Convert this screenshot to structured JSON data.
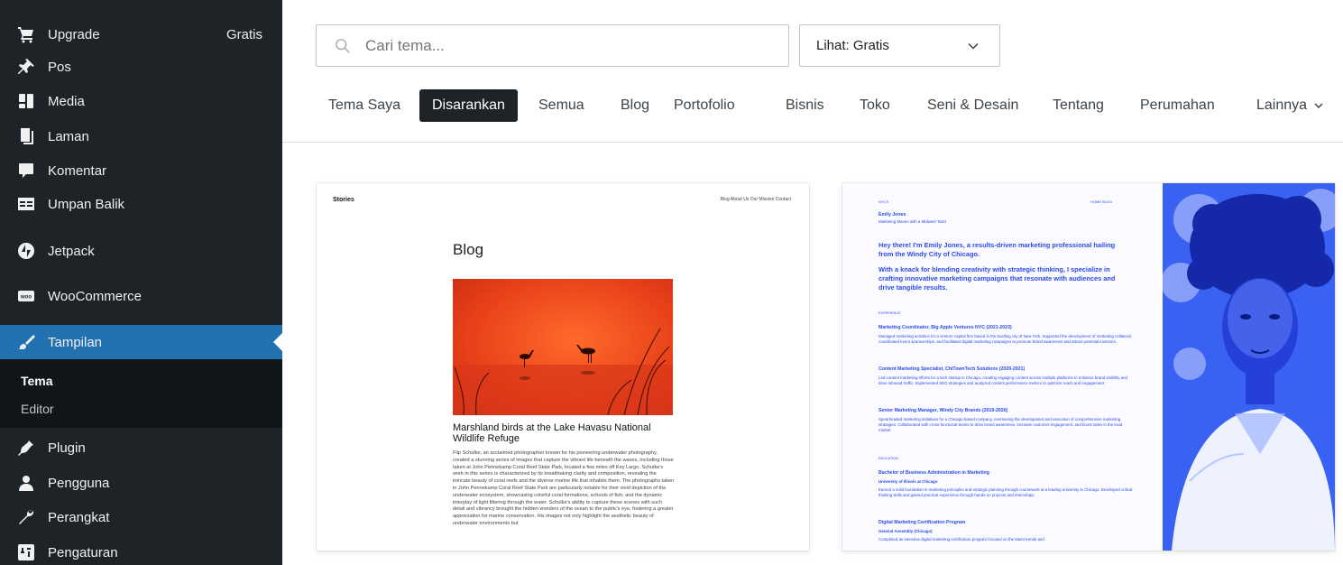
{
  "sidebar": {
    "items": [
      {
        "label": "Upgrade",
        "badge": "Gratis",
        "icon": "cart-icon"
      },
      {
        "label": "Pos",
        "icon": "pin-icon"
      },
      {
        "label": "Media",
        "icon": "media-icon"
      },
      {
        "label": "Laman",
        "icon": "page-icon"
      },
      {
        "label": "Komentar",
        "icon": "comment-icon"
      },
      {
        "label": "Umpan Balik",
        "icon": "feedback-icon"
      },
      {
        "label": "Jetpack",
        "icon": "jetpack-icon"
      },
      {
        "label": "WooCommerce",
        "icon": "woo-icon"
      },
      {
        "label": "Tampilan",
        "icon": "brush-icon"
      },
      {
        "label": "Plugin",
        "icon": "plugin-icon"
      },
      {
        "label": "Pengguna",
        "icon": "user-icon"
      },
      {
        "label": "Perangkat",
        "icon": "wrench-icon"
      },
      {
        "label": "Pengaturan",
        "icon": "settings-icon"
      }
    ],
    "submenu": [
      {
        "label": "Tema"
      },
      {
        "label": "Editor"
      }
    ]
  },
  "search": {
    "placeholder": "Cari tema...",
    "value": ""
  },
  "view_select": {
    "label": "Lihat: Gratis"
  },
  "tabs": [
    {
      "label": "Tema Saya"
    },
    {
      "label": "Disarankan"
    },
    {
      "label": "Semua"
    },
    {
      "label": "Blog"
    },
    {
      "label": "Portofolio"
    },
    {
      "label": "Bisnis"
    },
    {
      "label": "Toko"
    },
    {
      "label": "Seni & Desain"
    },
    {
      "label": "Tentang"
    },
    {
      "label": "Perumahan"
    },
    {
      "label": "Lainnya"
    }
  ],
  "cards": [
    {
      "site_title": "Stories",
      "nav": "Blog   About Us   Our Mission   Contact",
      "heading": "Blog",
      "post_title": "Marshland birds at the Lake Havasu National Wildlife Refuge",
      "post_body": "Flip Schulke, an acclaimed photographer known for his pioneering underwater photography, created a stunning series of images that capture the vibrant life beneath the waves, including those taken at John Pennekamp Coral Reef State Park, located a few miles off Key Largo. Schulke's work in this series is characterized by its breathtaking clarity and composition, revealing the intricate beauty of coral reefs and the diverse marine life that inhabits them. The photographs taken in John Pennekamp Coral Reef State Park are particularly notable for their vivid depiction of the underwater ecosystem, showcasing colorful coral formations, schools of fish, and the dynamic interplay of light filtering through the water. Schulke's ability to capture these scenes with such detail and vibrancy brought the hidden wonders of the ocean to the public's eye, fostering a greater appreciation for marine conservation. His images not only highlight the aesthetic beauty of underwater environments but"
    },
    {
      "tag": "NYCS",
      "nav": "HOME   BLOG",
      "name": "Emily Jones",
      "subtitle": "Marketing Maven with a Midwest Twist",
      "intro": "Hey there! I'm Emily Jones, a results-driven marketing professional hailing from the Windy City of Chicago.",
      "intro2": "With a knack for blending creativity with strategic thinking, I specialize in crafting innovative marketing campaigns that resonate with audiences and drive tangible results.",
      "experience_label": "EXPERIENCE",
      "job1_title": "Marketing Coordinator, Big Apple Ventures NYC (2021-2023)",
      "job1_desc": "Managed marketing activities for a venture capital firm based in the bustling city of New York. Supported the development of marketing collateral, coordinated event sponsorships, and facilitated digital marketing campaigns to promote brand awareness and attract potential investors.",
      "job2_title": "Content Marketing Specialist, ChiTownTech Solutions (2020-2021)",
      "job2_desc": "Led content marketing efforts for a tech startup in Chicago, creating engaging content across multiple platforms to enhance brand visibility and drive inbound traffic. Implemented SEO strategies and analyzed content performance metrics to optimize reach and engagement.",
      "job3_title": "Senior Marketing Manager, Windy City Brands (2019-2020)",
      "job3_desc": "Spearheaded marketing initiatives for a Chicago-based company, overseeing the development and execution of comprehensive marketing strategies. Collaborated with cross-functional teams to drive brand awareness, increase customer engagement, and boost sales in the local market.",
      "education_label": "EDUCATION",
      "edu1_title": "Bachelor of Business Administration in Marketing",
      "edu1_school": "University of Illinois at Chicago",
      "edu1_desc": "Earned a solid foundation in marketing principles and strategic planning through coursework at a leading university in Chicago. Developed critical thinking skills and gained practical experience through hands-on projects and internships.",
      "edu2_title": "Digital Marketing Certification Program",
      "edu2_school": "General Assembly (Chicago)",
      "edu2_desc": "Completed an intensive digital marketing certification program focused on the latest trends and"
    }
  ],
  "colors": {
    "sidebar_bg": "#1d2327",
    "active_bg": "#2271b1",
    "submenu_bg": "#101517",
    "tab_selected_bg": "#1d2327",
    "resume_blue": "#2b4bea",
    "photo_red": "#e8401a"
  }
}
